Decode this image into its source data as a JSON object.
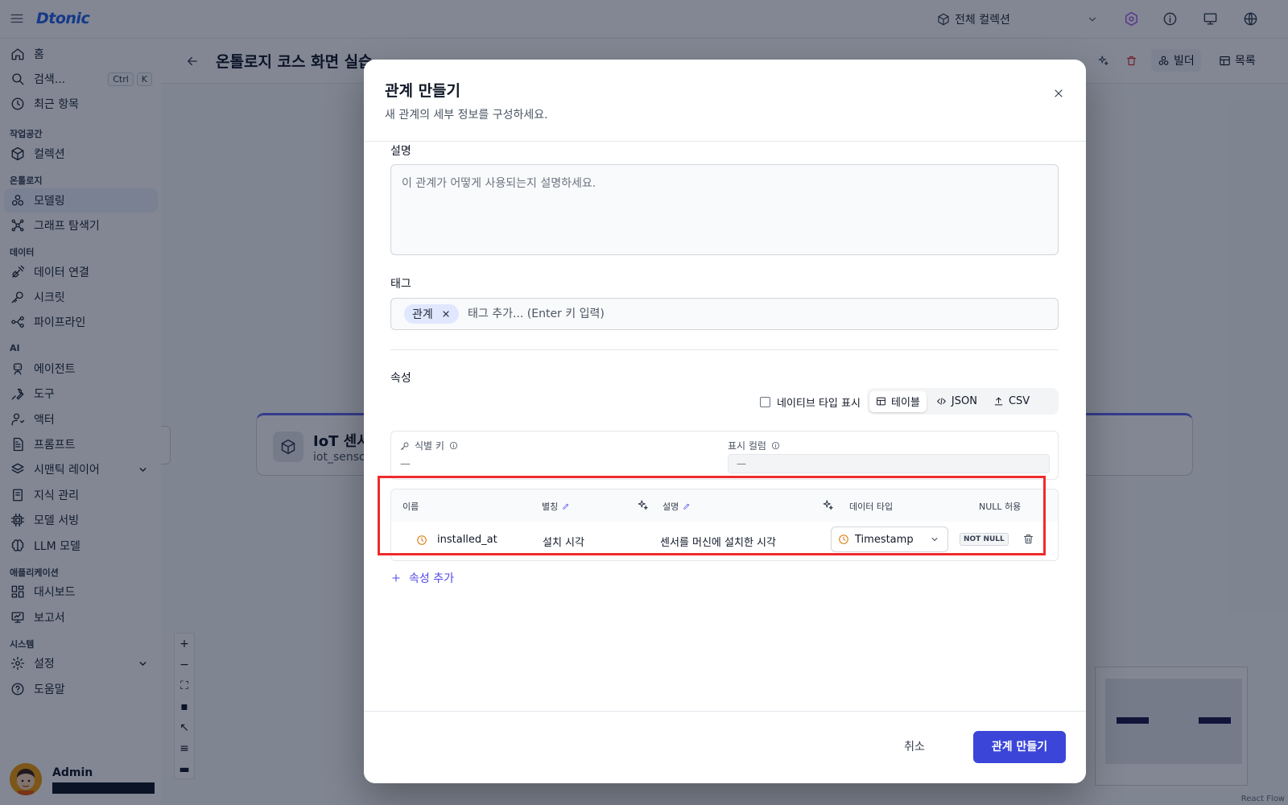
{
  "app": {
    "logo": "Dtonic",
    "collection_selector": "전체 컬렉션",
    "icons": [
      "menu-icon",
      "cube-icon",
      "chevron-down-icon",
      "ai-icon",
      "info-icon",
      "monitor-icon",
      "globe-icon"
    ]
  },
  "sidebar": {
    "search_shortcut": [
      "Ctrl",
      "K"
    ],
    "items": [
      {
        "label": "홈",
        "icon": "home-icon"
      },
      {
        "label": "검색...",
        "icon": "search-icon"
      },
      {
        "label": "최근 항목",
        "icon": "clock-icon"
      },
      {
        "label": "컬렉션",
        "icon": "cube-icon"
      },
      {
        "label": "모델링",
        "icon": "modeling-icon",
        "active": true
      },
      {
        "label": "그래프 탐색기",
        "icon": "graph-icon"
      },
      {
        "label": "데이터 연결",
        "icon": "plug-icon"
      },
      {
        "label": "시크릿",
        "icon": "key-icon"
      },
      {
        "label": "파이프라인",
        "icon": "pipeline-icon"
      },
      {
        "label": "에이전트",
        "icon": "robot-icon"
      },
      {
        "label": "도구",
        "icon": "wrench-icon"
      },
      {
        "label": "액터",
        "icon": "actor-icon"
      },
      {
        "label": "프롬프트",
        "icon": "document-icon"
      },
      {
        "label": "시맨틱 레이어",
        "icon": "layers-icon"
      },
      {
        "label": "지식 관리",
        "icon": "book-icon"
      },
      {
        "label": "모델 서빙",
        "icon": "chip-icon"
      },
      {
        "label": "LLM 모델",
        "icon": "brain-icon"
      },
      {
        "label": "대시보드",
        "icon": "dashboard-icon"
      },
      {
        "label": "보고서",
        "icon": "report-icon"
      },
      {
        "label": "설정",
        "icon": "gear-icon"
      },
      {
        "label": "도움말",
        "icon": "help-icon"
      }
    ],
    "sections": [
      "작업공간",
      "온톨로지",
      "데이터",
      "AI",
      "애플리케이션",
      "시스템"
    ],
    "user_name": "Admin"
  },
  "main": {
    "title": "온톨로지 코스 화면 실습",
    "builder_label": "빌더",
    "list_label": "목록",
    "node_title": "IoT 센서",
    "node_subtitle": "iot_senso",
    "react_flow": "React Flow"
  },
  "dialog": {
    "title": "관계 만들기",
    "description": "새 관계의 세부 정보를 구성하세요.",
    "desc_label": "설명",
    "desc_placeholder": "이 관계가 어떻게 사용되는지 설명하세요.",
    "tag_label": "태그",
    "tag_chip": "관계",
    "tag_placeholder": "태그 추가... (Enter 키 입력)",
    "attr_label": "속성",
    "native_type_label": "네이티브 타입 표시",
    "views": [
      "테이블",
      "JSON",
      "CSV"
    ],
    "id_key_label": "식별 키",
    "id_key_value": "—",
    "display_col_label": "표시 컬럼",
    "display_col_value": "—",
    "table_headers": {
      "name": "이름",
      "alias": "별칭",
      "desc": "설명",
      "type": "데이터 타입",
      "null": "NULL 허용"
    },
    "row": {
      "name": "installed_at",
      "alias": "설치 시각",
      "desc": "센서를 머신에 설치한 시각",
      "type": "Timestamp",
      "null_badge": "NOT NULL"
    },
    "add_attr": "속성 추가",
    "cancel": "취소",
    "submit": "관계 만들기"
  },
  "colors": {
    "accent": "#3b46d9",
    "highlight": "#ef2b2b",
    "timestamp_icon": "#d97706"
  }
}
